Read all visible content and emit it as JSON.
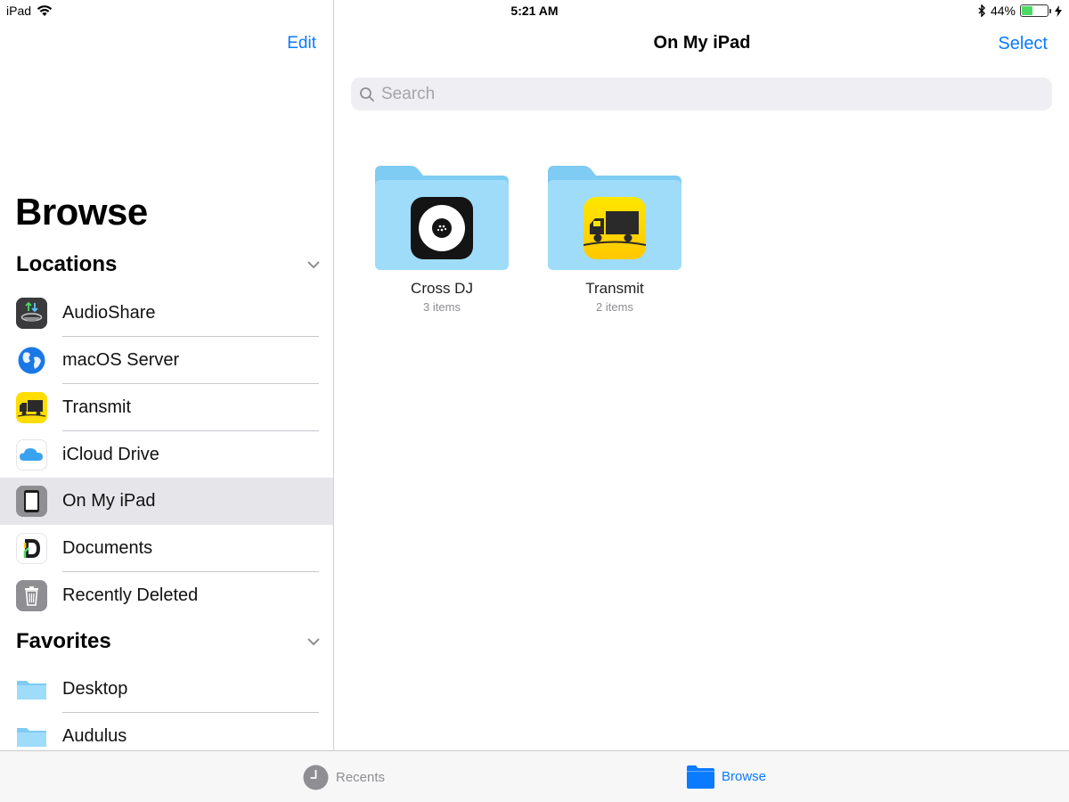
{
  "status_bar": {
    "device": "iPad",
    "time": "5:21 AM",
    "battery_percent": "44%",
    "battery_level": 0.44
  },
  "sidebar": {
    "edit_label": "Edit",
    "title": "Browse",
    "locations_header": "Locations",
    "locations": [
      {
        "label": "AudioShare",
        "icon": "audioshare-icon"
      },
      {
        "label": "macOS Server",
        "icon": "globe-icon"
      },
      {
        "label": "Transmit",
        "icon": "transmit-truck-icon"
      },
      {
        "label": "iCloud Drive",
        "icon": "icloud-icon"
      },
      {
        "label": "On My iPad",
        "icon": "ipad-icon",
        "selected": true
      },
      {
        "label": "Documents",
        "icon": "documents-icon"
      },
      {
        "label": "Recently Deleted",
        "icon": "trash-icon"
      }
    ],
    "favorites_header": "Favorites",
    "favorites": [
      {
        "label": "Desktop",
        "icon": "folder-icon"
      },
      {
        "label": "Audulus",
        "icon": "folder-icon"
      }
    ]
  },
  "main": {
    "title": "On My iPad",
    "select_label": "Select",
    "search_placeholder": "Search",
    "folders": [
      {
        "name": "Cross DJ",
        "count": "3 items",
        "icon": "cross-dj-icon"
      },
      {
        "name": "Transmit",
        "count": "2 items",
        "icon": "transmit-truck-icon"
      }
    ]
  },
  "tab_bar": {
    "tabs": [
      {
        "label": "Recents",
        "icon": "clock-icon",
        "active": false
      },
      {
        "label": "Browse",
        "icon": "folder-icon",
        "active": true
      }
    ]
  },
  "colors": {
    "accent": "#0a7aff",
    "selected_row": "#e6e6ea",
    "folder_light": "#9fdcfa",
    "folder_dark": "#7ecbf3"
  }
}
